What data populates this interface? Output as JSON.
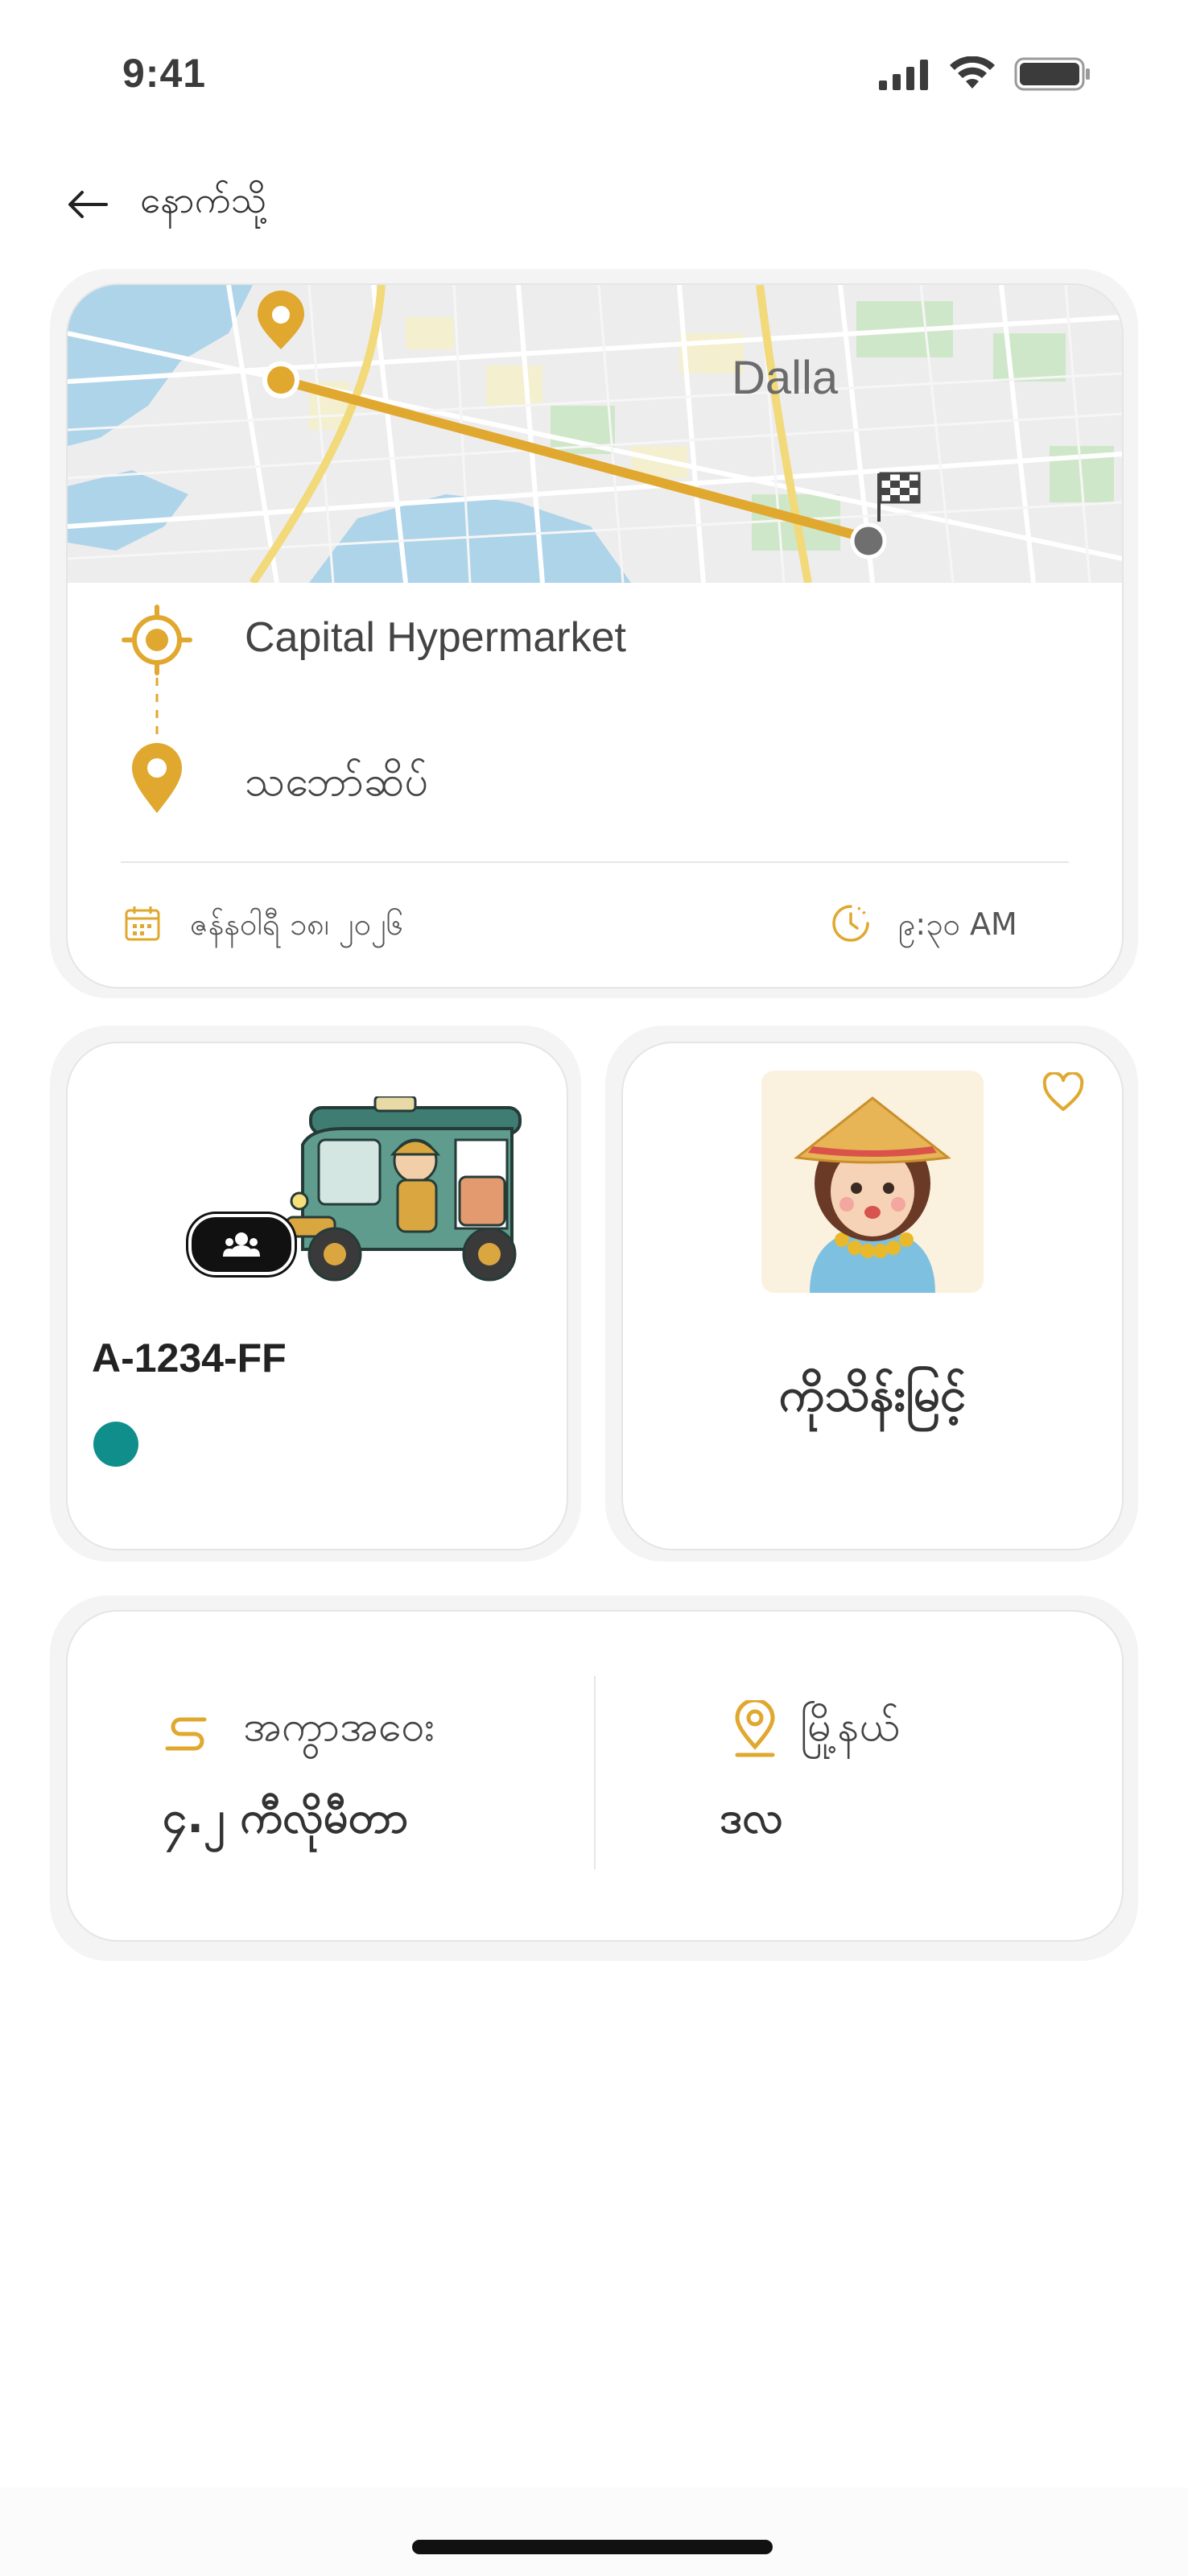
{
  "status_bar": {
    "time": "9:41"
  },
  "header": {
    "back_label": "နောက်သို့"
  },
  "map": {
    "place_label": "Dalla"
  },
  "route": {
    "pickup": "Capital Hypermarket",
    "dropoff": "သဘော်ဆိပ်",
    "date": "ဇန်နဝါရီ ၁၈၊ ၂၀၂၆",
    "time": "၉:၃၀ AM"
  },
  "vehicle": {
    "plate": "A-1234-FF",
    "color": "#0f8e8c"
  },
  "driver": {
    "name": "ကိုသိန်းမြင့်"
  },
  "info": {
    "distance_label": "အကွာအဝေး",
    "distance_value": "၄.၂ ကီလိုမီတာ",
    "township_label": "မြို့နယ်",
    "township_value": "ဒလ"
  },
  "colors": {
    "accent": "#e0a82e",
    "vehicle_dot": "#0f8e8c"
  }
}
